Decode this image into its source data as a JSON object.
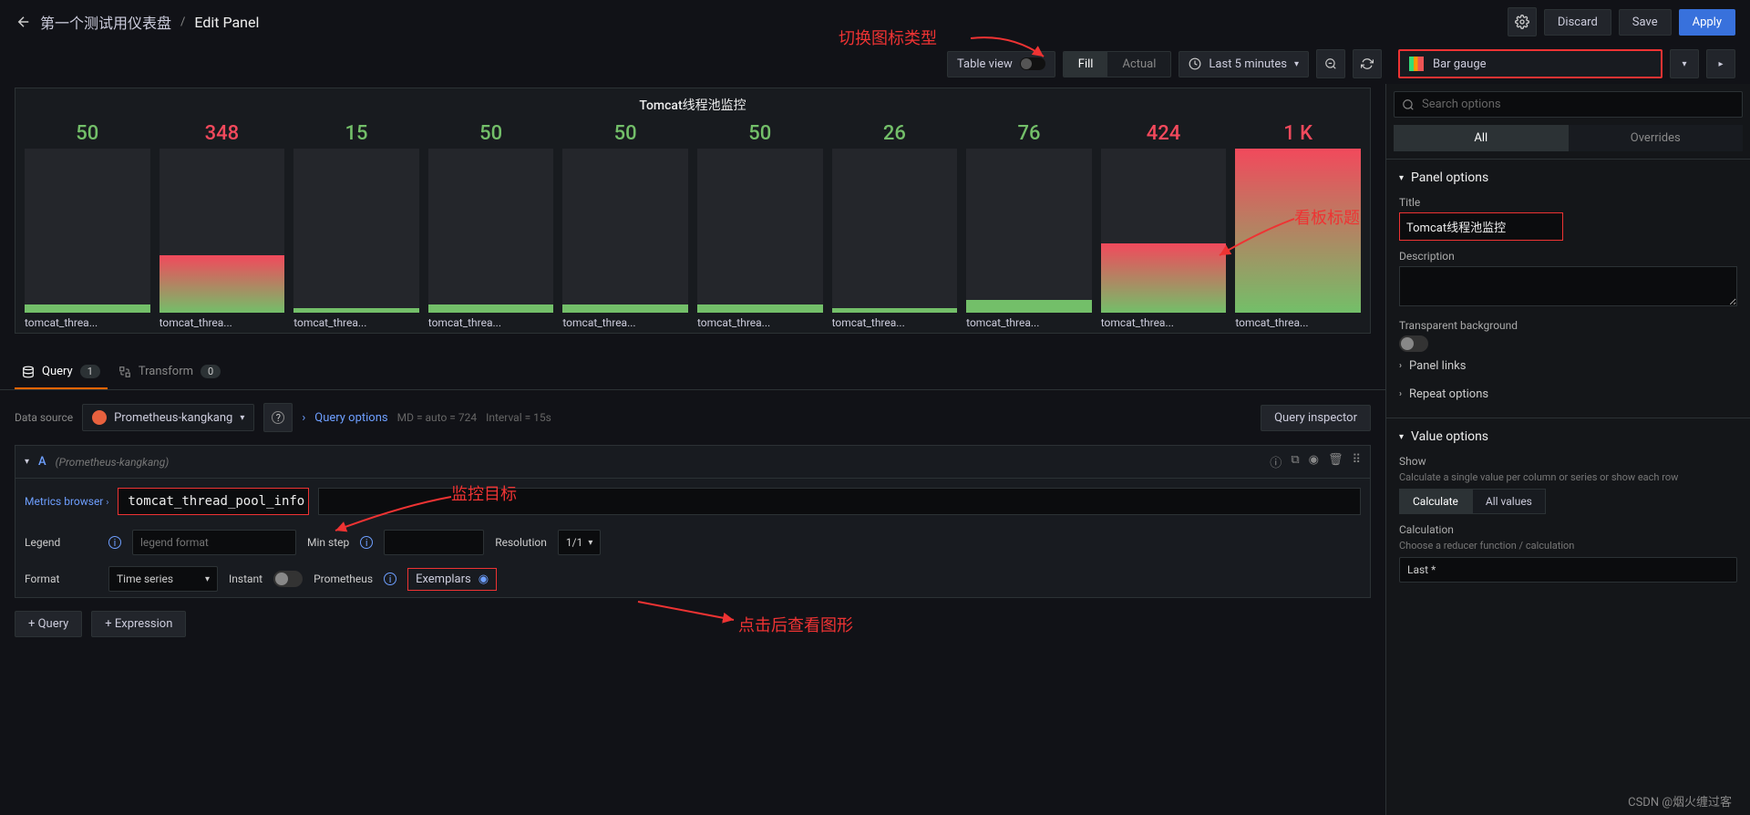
{
  "header": {
    "dashboard_name": "第一个测试用仪表盘",
    "current": "Edit Panel",
    "discard": "Discard",
    "save": "Save",
    "apply": "Apply"
  },
  "toolbar": {
    "table_view": "Table view",
    "fill": "Fill",
    "actual": "Actual",
    "time_range": "Last 5 minutes",
    "viz_type": "Bar gauge"
  },
  "panel": {
    "title": "Tomcat线程池监控"
  },
  "chart_data": {
    "type": "bar",
    "title": "Tomcat线程池监控",
    "ylim": [
      0,
      1000
    ],
    "categories": [
      "tomcat_threa...",
      "tomcat_threa...",
      "tomcat_threa...",
      "tomcat_threa...",
      "tomcat_threa...",
      "tomcat_threa...",
      "tomcat_threa...",
      "tomcat_threa...",
      "tomcat_threa...",
      "tomcat_threa..."
    ],
    "values": [
      50,
      348,
      15,
      50,
      50,
      50,
      26,
      76,
      424,
      1000
    ],
    "display_values": [
      "50",
      "348",
      "15",
      "50",
      "50",
      "50",
      "26",
      "76",
      "424",
      "1 K"
    ],
    "value_colors": [
      "#73bf69",
      "#f2495c",
      "#73bf69",
      "#73bf69",
      "#73bf69",
      "#73bf69",
      "#73bf69",
      "#73bf69",
      "#f2495c",
      "#f2495c"
    ]
  },
  "tabs": {
    "query": "Query",
    "query_count": "1",
    "transform": "Transform",
    "transform_count": "0"
  },
  "datasource": {
    "label": "Data source",
    "name": "Prometheus-kangkang",
    "query_options": "Query options",
    "md": "MD = auto = 724",
    "interval": "Interval = 15s",
    "inspector": "Query inspector"
  },
  "query": {
    "letter": "A",
    "ds_hint": "(Prometheus-kangkang)",
    "metrics_browser": "Metrics browser",
    "expr": "tomcat_thread_pool_info",
    "legend_label": "Legend",
    "legend_placeholder": "legend format",
    "min_step": "Min step",
    "resolution": "Resolution",
    "resolution_val": "1/1",
    "format": "Format",
    "format_val": "Time series",
    "instant": "Instant",
    "prometheus": "Prometheus",
    "exemplars": "Exemplars"
  },
  "add": {
    "query": "+ Query",
    "expression": "+ Expression"
  },
  "sidebar": {
    "search_placeholder": "Search options",
    "all": "All",
    "overrides": "Overrides",
    "panel_options": "Panel options",
    "title": "Title",
    "title_val": "Tomcat线程池监控",
    "description": "Description",
    "transparent": "Transparent background",
    "panel_links": "Panel links",
    "repeat": "Repeat options",
    "value_options": "Value options",
    "show": "Show",
    "show_help": "Calculate a single value per column or series or show each row",
    "calculate": "Calculate",
    "all_values": "All values",
    "calculation": "Calculation",
    "calc_help": "Choose a reducer function / calculation",
    "calc_val": "Last *"
  },
  "annotations": {
    "viz_switch": "切换图标类型",
    "panel_title": "看板标题",
    "monitor_target": "监控目标",
    "exemplars": "点击后查看图形"
  },
  "watermark": "CSDN @烟火缠过客"
}
